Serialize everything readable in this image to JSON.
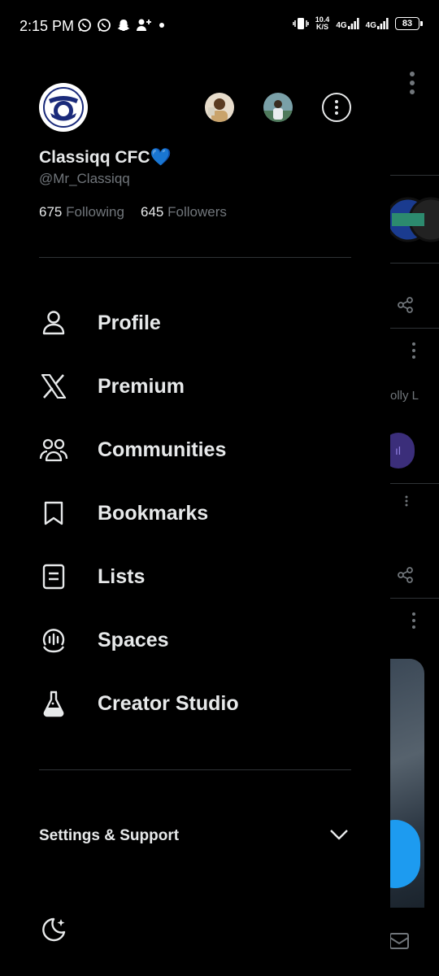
{
  "status_bar": {
    "time": "2:15 PM",
    "speed_top": "10.4",
    "speed_bottom": "K/S",
    "net1": "4G",
    "net2": "4G",
    "battery": "83",
    "left_icons": [
      "whatsapp-icon",
      "whatsapp-icon",
      "snapchat-icon",
      "add-user-icon",
      "dot-icon"
    ]
  },
  "profile": {
    "name": "Classiqq CFC💙",
    "handle": "@Mr_Classiqq",
    "following_count": "675",
    "following_label": "Following",
    "followers_count": "645",
    "followers_label": "Followers"
  },
  "menu": [
    {
      "label": "Profile",
      "icon": "person-icon"
    },
    {
      "label": "Premium",
      "icon": "x-logo-icon"
    },
    {
      "label": "Communities",
      "icon": "communities-icon"
    },
    {
      "label": "Bookmarks",
      "icon": "bookmark-icon"
    },
    {
      "label": "Lists",
      "icon": "list-icon"
    },
    {
      "label": "Spaces",
      "icon": "spaces-icon"
    },
    {
      "label": "Creator Studio",
      "icon": "flask-icon"
    }
  ],
  "settings": {
    "label": "Settings & Support"
  },
  "background": {
    "peek_text": "olly L"
  },
  "colors": {
    "background": "#000000",
    "text": "#e7e9ea",
    "muted": "#71767b",
    "divider": "#2f3336",
    "accent": "#1d9bf0"
  }
}
